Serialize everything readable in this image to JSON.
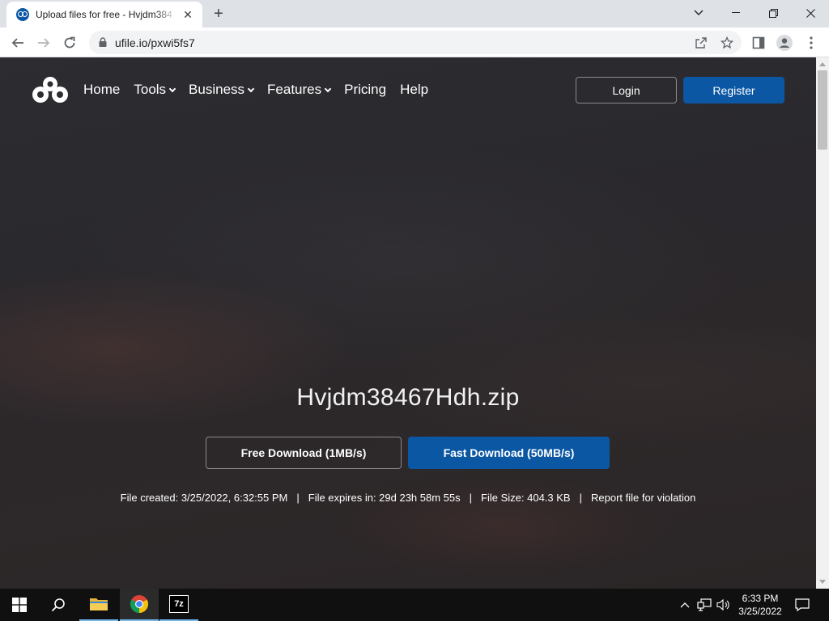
{
  "browser": {
    "tab_title": "Upload files for free - Hvjdm384",
    "url": "ufile.io/pxwi5fs7"
  },
  "site": {
    "nav": [
      {
        "label": "Home",
        "dropdown": false
      },
      {
        "label": "Tools",
        "dropdown": true
      },
      {
        "label": "Business",
        "dropdown": true
      },
      {
        "label": "Features",
        "dropdown": true
      },
      {
        "label": "Pricing",
        "dropdown": false
      },
      {
        "label": "Help",
        "dropdown": false
      }
    ],
    "login_label": "Login",
    "register_label": "Register"
  },
  "file": {
    "name": "Hvjdm38467Hdh.zip",
    "free_download_label": "Free Download (1MB/s)",
    "fast_download_label": "Fast Download (50MB/s)",
    "created": "File created: 3/25/2022, 6:32:55 PM",
    "expires": "File expires in: 29d 23h 58m 55s",
    "size": "File Size: 404.3 KB",
    "report": "Report file for violation",
    "separator": "|"
  },
  "taskbar": {
    "time": "6:33 PM",
    "date": "3/25/2022",
    "sevenzip_label": "7z"
  },
  "colors": {
    "brand_blue": "#0b57a4",
    "page_bg": "#2b292d"
  }
}
